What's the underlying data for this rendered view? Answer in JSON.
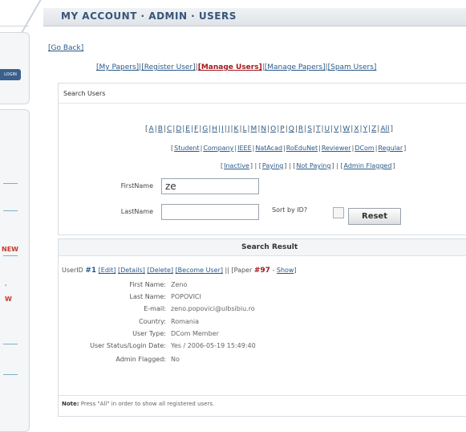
{
  "sidebar": {
    "login_label": "LOGIN",
    "new_label": "NEW",
    "w_label": "W",
    "dot_label": "‹"
  },
  "header": {
    "title": "MY ACCOUNT · ADMIN · USERS"
  },
  "go_back": "[Go Back]",
  "nav": [
    {
      "label": "[My Papers]",
      "active": false
    },
    {
      "label": "[Register User]",
      "active": false
    },
    {
      "label": "[Manage Users]",
      "active": true
    },
    {
      "label": "[Manage Papers]",
      "active": false
    },
    {
      "label": "[Spam Users]",
      "active": false
    }
  ],
  "search": {
    "title": "Search Users",
    "letters": [
      "A",
      "B",
      "C",
      "D",
      "E",
      "F",
      "G",
      "H",
      "I",
      "J",
      "K",
      "L",
      "M",
      "N",
      "O",
      "P",
      "Q",
      "R",
      "S",
      "T",
      "U",
      "V",
      "W",
      "X",
      "Y",
      "Z",
      "All"
    ],
    "types": [
      "Student",
      "Company",
      "IEEE",
      "NatAcad",
      "RoEduNet",
      "Reviewer",
      "DCom",
      "Regular"
    ],
    "status": [
      "Inactive",
      "Paying",
      "Not Paying",
      "Admin Flagged"
    ],
    "firstname_label": "FirstName",
    "firstname_value": "ze",
    "lastname_label": "LastName",
    "lastname_value": "",
    "sort_label": "Sort by ID?",
    "reset_label": "Reset"
  },
  "result": {
    "title": "Search Result",
    "user_prefix": "UserID",
    "user_id": "#1",
    "links": [
      "[Edit]",
      "[Details]",
      "[Delete]",
      "[Become User]"
    ],
    "paper_prefix": "|| [Paper",
    "paper_id": "#97",
    "paper_show": "Show",
    "fields": [
      {
        "label": "First Name:",
        "value": "Zeno"
      },
      {
        "label": "Last Name:",
        "value": "POPOVICI"
      },
      {
        "label": "E-mail:",
        "value": "zeno.popovici@ulbsibiu.ro"
      },
      {
        "label": "Country:",
        "value": "Romania"
      },
      {
        "label": "User Type:",
        "value": "DCom Member"
      },
      {
        "label": "User Status/Login Date:",
        "value": "Yes / 2006-05-19 15:49:40"
      },
      {
        "label": "Admin Flagged:",
        "value": "No"
      }
    ],
    "note_label": "Note:",
    "note_text": "Press \"All\" in order to show all registered users."
  }
}
